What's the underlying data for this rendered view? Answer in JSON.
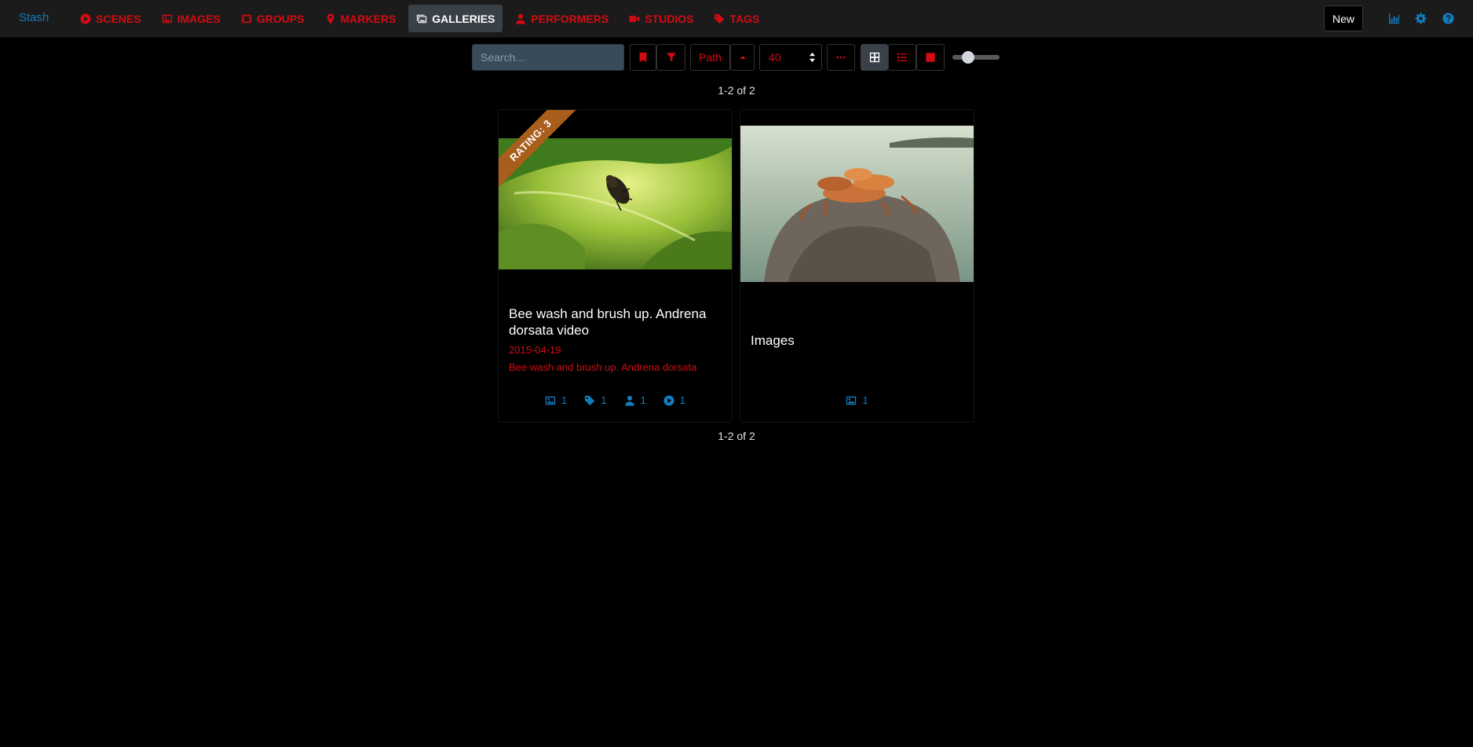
{
  "nav": {
    "brand": "Stash",
    "items": [
      {
        "label": "SCENES",
        "icon": "play-circle-icon"
      },
      {
        "label": "IMAGES",
        "icon": "image-icon"
      },
      {
        "label": "GROUPS",
        "icon": "film-icon"
      },
      {
        "label": "MARKERS",
        "icon": "map-marker-icon"
      },
      {
        "label": "GALLERIES",
        "icon": "images-icon",
        "active": true
      },
      {
        "label": "PERFORMERS",
        "icon": "user-icon"
      },
      {
        "label": "STUDIOS",
        "icon": "video-icon"
      },
      {
        "label": "TAGS",
        "icon": "tag-icon"
      }
    ],
    "new_label": "New",
    "right_icons": [
      "chart-icon",
      "gear-icon",
      "help-icon"
    ]
  },
  "toolbar": {
    "search_placeholder": "Search...",
    "sort_label": "Path",
    "per_page": "40"
  },
  "pagination": {
    "top": "1-2 of 2",
    "bottom": "1-2 of 2"
  },
  "galleries": [
    {
      "title": "Bee wash and brush up. Andrena dorsata video",
      "date": "2015-04-19",
      "description": "Bee wash and brush up. Andrena dorsata",
      "rating": "RATING: 3",
      "stats": {
        "images": "1",
        "tags": "1",
        "performers": "1",
        "scenes": "1"
      }
    },
    {
      "title": "Images",
      "stats": {
        "images": "1"
      }
    }
  ],
  "colors": {
    "accent_red": "#d20b12",
    "link_blue": "#137cbd",
    "nav_bg": "#1b1b1b",
    "active_bg": "#394048",
    "ribbon": "#a85f1c"
  }
}
